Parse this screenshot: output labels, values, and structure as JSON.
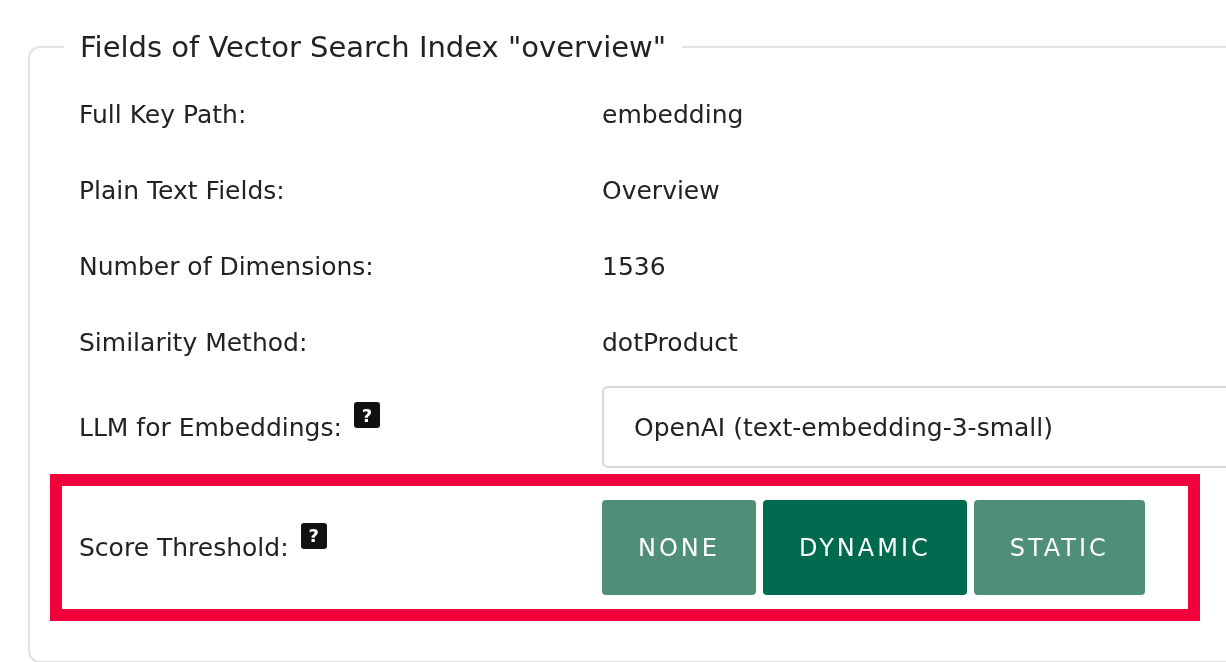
{
  "panel": {
    "title": "Fields of Vector Search Index \"overview\""
  },
  "fields": [
    {
      "kind": "text",
      "label": "Full Key Path:",
      "value": "embedding"
    },
    {
      "kind": "text",
      "label": "Plain Text Fields:",
      "value": "Overview"
    },
    {
      "kind": "text",
      "label": "Number of Dimensions:",
      "value": "1536"
    },
    {
      "kind": "text",
      "label": "Similarity Method:",
      "value": "dotProduct"
    },
    {
      "kind": "select",
      "label": "LLM for Embeddings:",
      "help": "?",
      "value": "OpenAI (text-embedding-3-small)"
    },
    {
      "kind": "toggle",
      "label": "Score Threshold:",
      "help": "?",
      "highlighted": true,
      "options": [
        {
          "label": "NONE",
          "selected": false
        },
        {
          "label": "DYNAMIC",
          "selected": true
        },
        {
          "label": "STATIC",
          "selected": false
        }
      ]
    }
  ]
}
